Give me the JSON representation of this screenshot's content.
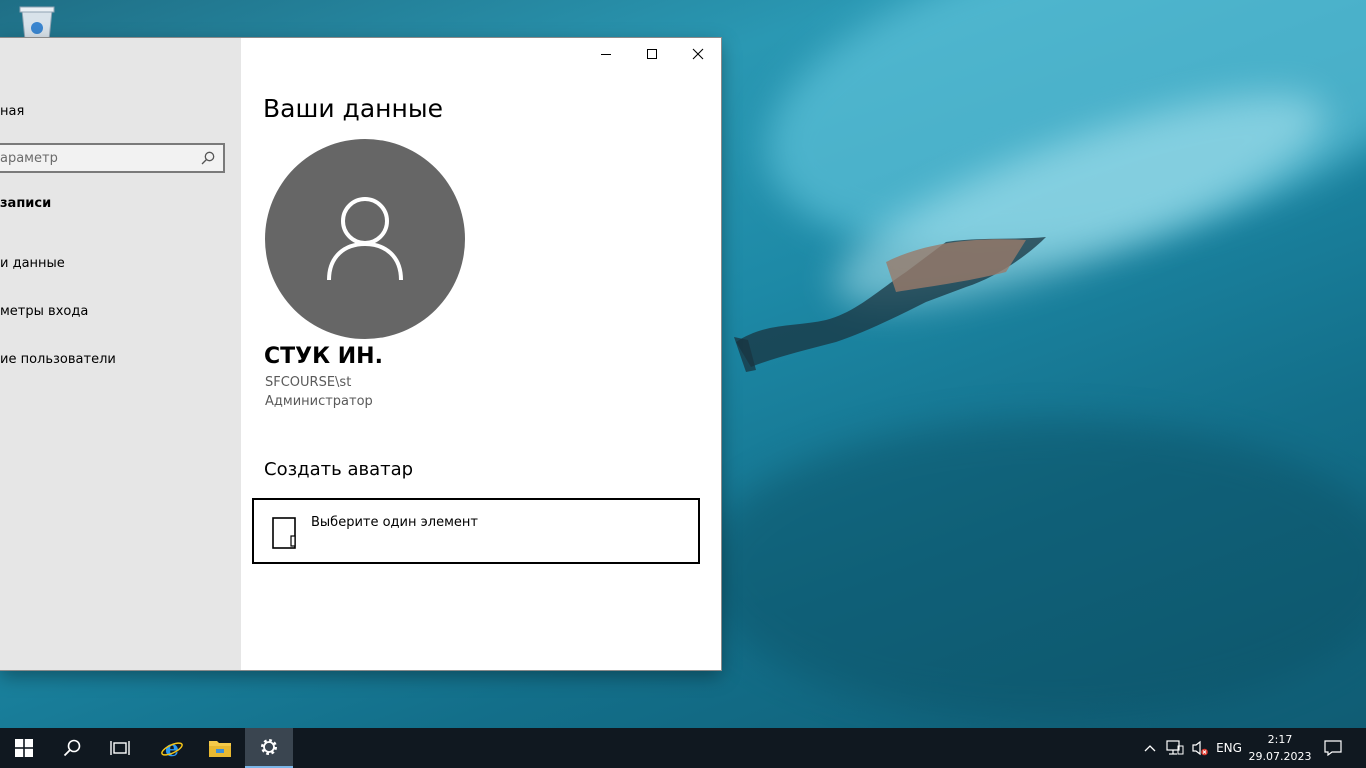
{
  "desktop": {
    "recycle_bin_icon": "recycle-bin-icon"
  },
  "window": {
    "controls": {
      "minimize_icon": "minimize-icon",
      "maximize_icon": "maximize-icon",
      "close_icon": "close-icon"
    },
    "sidebar": {
      "home_label": "ная",
      "search_placeholder": "араметр",
      "section_title": "записи",
      "items": [
        {
          "label": "и данные"
        },
        {
          "label": "метры входа"
        },
        {
          "label": "ие пользователи"
        }
      ]
    },
    "content": {
      "page_title": "Ваши данные",
      "avatar_icon": "user-avatar-icon",
      "user_name": "СТУК ИН.",
      "user_account": "SFCOURSE\\st",
      "user_role": "Администратор",
      "create_avatar_title": "Создать аватар",
      "pick_item_label": "Выберите один элемент"
    }
  },
  "taskbar": {
    "buttons": [
      "start-icon",
      "search-icon",
      "task-view-icon",
      "internet-explorer-icon",
      "file-explorer-icon",
      "settings-gear-icon"
    ],
    "tray": {
      "language": "ENG",
      "time": "2:17",
      "date": "29.07.2023"
    }
  },
  "colors": {
    "sidebar_bg": "#e6e6e6",
    "avatar_bg": "#666666",
    "taskbar_bg": "#101820"
  }
}
